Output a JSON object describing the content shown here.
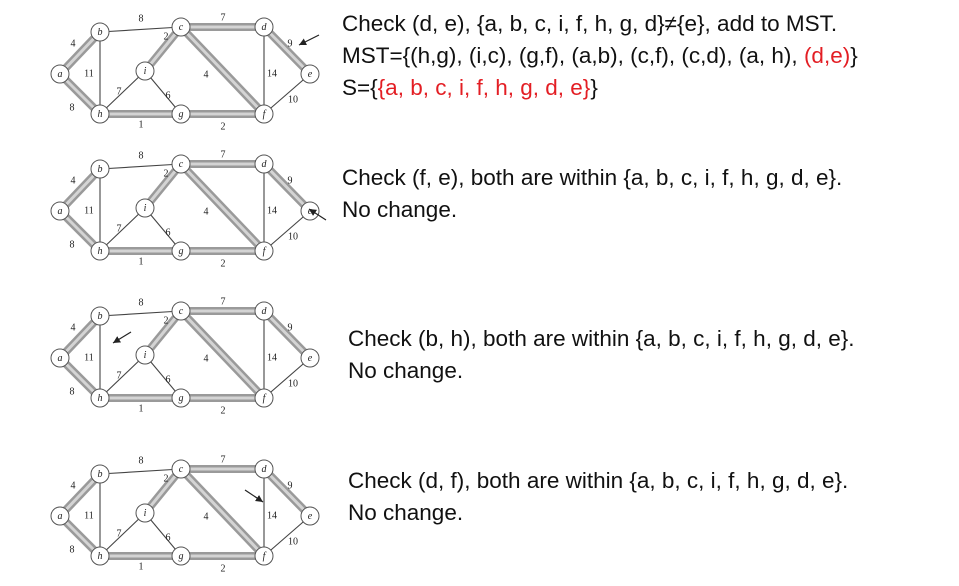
{
  "graph": {
    "nodes": [
      {
        "id": "a",
        "label": "a"
      },
      {
        "id": "b",
        "label": "b"
      },
      {
        "id": "c",
        "label": "c"
      },
      {
        "id": "d",
        "label": "d"
      },
      {
        "id": "e",
        "label": "e"
      },
      {
        "id": "f",
        "label": "f"
      },
      {
        "id": "g",
        "label": "g"
      },
      {
        "id": "h",
        "label": "h"
      },
      {
        "id": "i",
        "label": "i"
      }
    ],
    "edges": [
      {
        "id": "a-b",
        "from": "a",
        "to": "b",
        "weight": "4"
      },
      {
        "id": "a-h",
        "from": "a",
        "to": "h",
        "weight": "8"
      },
      {
        "id": "b-c",
        "from": "b",
        "to": "c",
        "weight": "8"
      },
      {
        "id": "b-h",
        "from": "b",
        "to": "h",
        "weight": "11"
      },
      {
        "id": "c-d",
        "from": "c",
        "to": "d",
        "weight": "7"
      },
      {
        "id": "c-i",
        "from": "c",
        "to": "i",
        "weight": "2"
      },
      {
        "id": "c-f",
        "from": "c",
        "to": "f",
        "weight": "4"
      },
      {
        "id": "d-e",
        "from": "d",
        "to": "e",
        "weight": "9"
      },
      {
        "id": "d-f",
        "from": "d",
        "to": "f",
        "weight": "14"
      },
      {
        "id": "e-f",
        "from": "e",
        "to": "f",
        "weight": "10"
      },
      {
        "id": "f-g",
        "from": "f",
        "to": "g",
        "weight": "2"
      },
      {
        "id": "g-h",
        "from": "g",
        "to": "h",
        "weight": "1"
      },
      {
        "id": "g-i",
        "from": "g",
        "to": "i",
        "weight": "6"
      },
      {
        "id": "h-i",
        "from": "h",
        "to": "i",
        "weight": "7"
      }
    ],
    "mst_edges": [
      "a-b",
      "a-h",
      "c-d",
      "c-i",
      "c-f",
      "d-e",
      "f-g",
      "g-h"
    ]
  },
  "steps": [
    {
      "arrow_edge": "d-e",
      "line1": "Check (d, e), {a, b, c, i, f, h, g, d}≠{e}, add to MST.",
      "line2_prefix": "MST={(h,g), (i,c), (g,f), (a,b), (c,f), (c,d), (a, h), ",
      "line2_highlight": "(d,e)",
      "line2_suffix": "}",
      "line3_prefix": "S={",
      "line3_highlight": "{a, b, c, i, f, h, g, d, e}",
      "line3_suffix": "}"
    },
    {
      "arrow_edge": "e-f",
      "line1": "Check (f, e), both are within  {a, b, c, i, f, h, g, d, e}.",
      "line2": "No change."
    },
    {
      "arrow_edge": "b-h",
      "line1": "Check (b, h), both are within  {a, b, c, i, f, h, g, d, e}.",
      "line2": "No change."
    },
    {
      "arrow_edge": "d-f",
      "line1": "Check (d, f), both are within  {a, b, c, i, f, h, g, d, e}.",
      "line2": "No change."
    }
  ],
  "colors": {
    "mst_edge": "#9a9a9a",
    "mst_edge_core": "#d4d4d4",
    "edge": "#444444",
    "highlight_text": "#e31e24",
    "node_fill": "#ffffff",
    "node_stroke": "#555555"
  }
}
